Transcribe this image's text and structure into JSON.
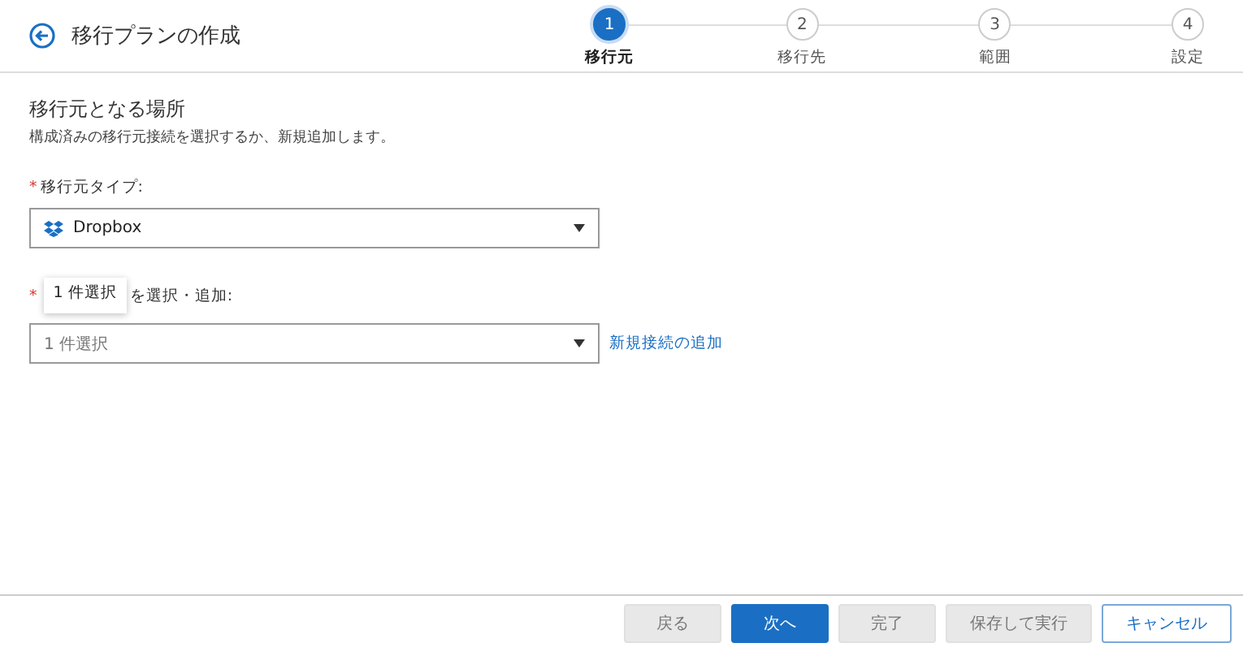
{
  "header": {
    "title": "移行プランの作成"
  },
  "steps": [
    {
      "number": "1",
      "label": "移行元",
      "selected": true
    },
    {
      "number": "2",
      "label": "移行先",
      "selected": false
    },
    {
      "number": "3",
      "label": "範囲",
      "selected": false
    },
    {
      "number": "4",
      "label": "設定",
      "selected": false
    }
  ],
  "section": {
    "title": "移行元となる場所",
    "description": "構成済みの移行元接続を選択するか、新規追加します。"
  },
  "source_type": {
    "required_mark": "*",
    "label": "移行元タイプ:",
    "value": "Dropbox"
  },
  "connection": {
    "required_mark": "*",
    "tooltip": "1 件選択",
    "label": "を選択・追加:",
    "value": "1 件選択",
    "link": "新規接続の追加"
  },
  "buttons": [
    {
      "label": "戻る",
      "kind": "secondary",
      "disabled": true
    },
    {
      "label": "次へ",
      "kind": "primary",
      "disabled": false
    },
    {
      "label": "完了",
      "kind": "secondary",
      "disabled": true
    },
    {
      "label": "保存して実行",
      "kind": "secondary",
      "disabled": true
    },
    {
      "label": "キャンセル",
      "kind": "outline",
      "disabled": false
    }
  ]
}
